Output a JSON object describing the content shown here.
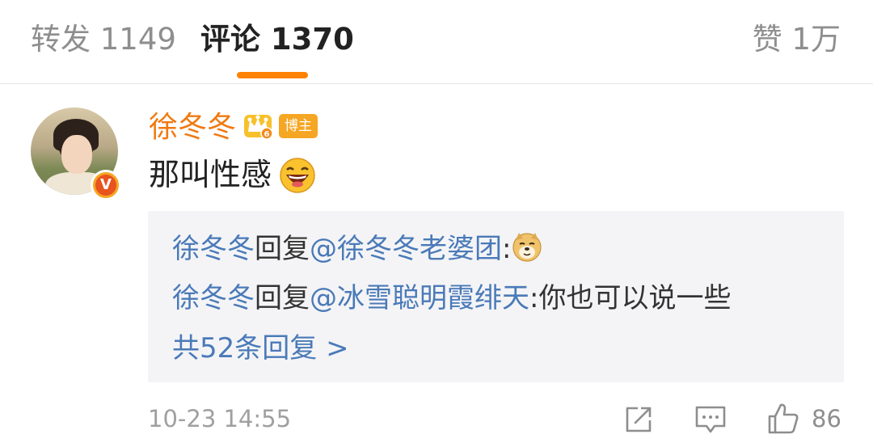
{
  "tabs": {
    "repost": "转发 1149",
    "comments": "评论 1370",
    "likes": "赞 1万",
    "active_color": "#ff8200"
  },
  "comment": {
    "username": "徐冬冬",
    "badge": "博主",
    "text": "那叫性感",
    "emoji": "laugh-emoji-icon",
    "timestamp": "10-23 14:55",
    "like_count": "86"
  },
  "replies": [
    {
      "author": "徐冬冬",
      "verb": "回复",
      "target": "@徐冬冬老婆团",
      "sep": ":",
      "text": "",
      "emoji": "doge-emoji-icon"
    },
    {
      "author": "徐冬冬",
      "verb": "回复",
      "target": "@冰雪聪明霞绯天",
      "sep": ":",
      "text": "你也可以说一些"
    }
  ],
  "more_replies": "共52条回复 >",
  "colors": {
    "username": "#f07a12",
    "link": "#4a7ab8",
    "badge": "#f5a623"
  }
}
